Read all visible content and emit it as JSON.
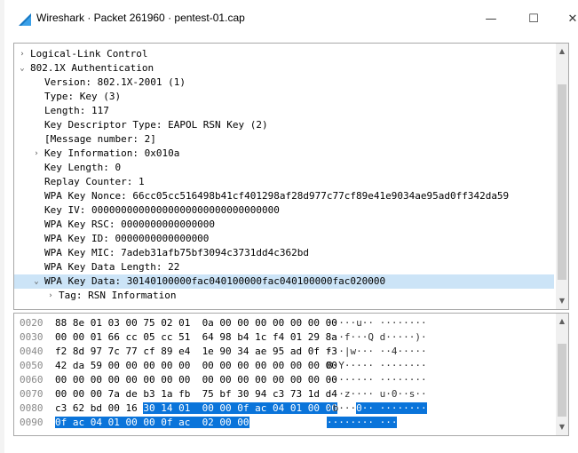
{
  "window": {
    "title": "Wireshark · Packet 261960 · pentest-01.cap",
    "minimize": "—",
    "maximize": "☐",
    "close": "✕"
  },
  "tree": {
    "rows": [
      {
        "text": "Logical-Link Control",
        "expander": "›"
      },
      {
        "text": "802.1X Authentication",
        "expander": "⌄"
      },
      {
        "text": "Version: 802.1X-2001 (1)",
        "expander": ""
      },
      {
        "text": "Type: Key (3)",
        "expander": ""
      },
      {
        "text": "Length: 117",
        "expander": ""
      },
      {
        "text": "Key Descriptor Type: EAPOL RSN Key (2)",
        "expander": ""
      },
      {
        "text": "[Message number: 2]",
        "expander": ""
      },
      {
        "text": "Key Information: 0x010a",
        "expander": "›"
      },
      {
        "text": "Key Length: 0",
        "expander": ""
      },
      {
        "text": "Replay Counter: 1",
        "expander": ""
      },
      {
        "text": "WPA Key Nonce: 66cc05cc516498b41cf401298af28d977c77cf89e41e9034ae95ad0ff342da59",
        "expander": ""
      },
      {
        "text": "Key IV: 00000000000000000000000000000000",
        "expander": ""
      },
      {
        "text": "WPA Key RSC: 0000000000000000",
        "expander": ""
      },
      {
        "text": "WPA Key ID: 0000000000000000",
        "expander": ""
      },
      {
        "text": "WPA Key MIC: 7adeb31afb75bf3094c3731dd4c362bd",
        "expander": ""
      },
      {
        "text": "WPA Key Data Length: 22",
        "expander": ""
      },
      {
        "text": "WPA Key Data: 30140100000fac040100000fac040100000fac020000",
        "expander": "⌄"
      },
      {
        "text": "Tag: RSN Information",
        "expander": "›"
      }
    ]
  },
  "hex": {
    "rows": [
      {
        "offset": "0020",
        "bytes": "88 8e 01 03 00 75 02 01  0a 00 00 00 00 00 00 00",
        "ascii": "·····u·· ········"
      },
      {
        "offset": "0030",
        "bytes": "00 00 01 66 cc 05 cc 51  64 98 b4 1c f4 01 29 8a",
        "ascii": "···f···Q d·····)·"
      },
      {
        "offset": "0040",
        "bytes": "f2 8d 97 7c 77 cf 89 e4  1e 90 34 ae 95 ad 0f f3",
        "ascii": "···|w··· ··4·····"
      },
      {
        "offset": "0050",
        "bytes": "42 da 59 00 00 00 00 00  00 00 00 00 00 00 00 00",
        "ascii": "B·Y····· ········"
      },
      {
        "offset": "0060",
        "bytes": "00 00 00 00 00 00 00 00  00 00 00 00 00 00 00 00",
        "ascii": "········ ········"
      },
      {
        "offset": "0070",
        "bytes": "00 00 00 7a de b3 1a fb  75 bf 30 94 c3 73 1d d4",
        "ascii": "···z···· u·0··s··"
      },
      {
        "offset": "0080",
        "bytes_plain": "c3 62 bd 00 16 ",
        "bytes_sel": "30 14 01  00 00 0f ac 04 01 00 00",
        "ascii_plain": "·b···",
        "ascii_sel": "0·· ········"
      },
      {
        "offset": "0090",
        "bytes_plain": "",
        "bytes_sel": "0f ac 04 01 00 00 0f ac  02 00 00",
        "ascii_plain": "",
        "ascii_sel": "········ ···"
      }
    ]
  },
  "colors": {
    "selection_row": "#cce4f7",
    "hex_selection": "#0a74da"
  }
}
